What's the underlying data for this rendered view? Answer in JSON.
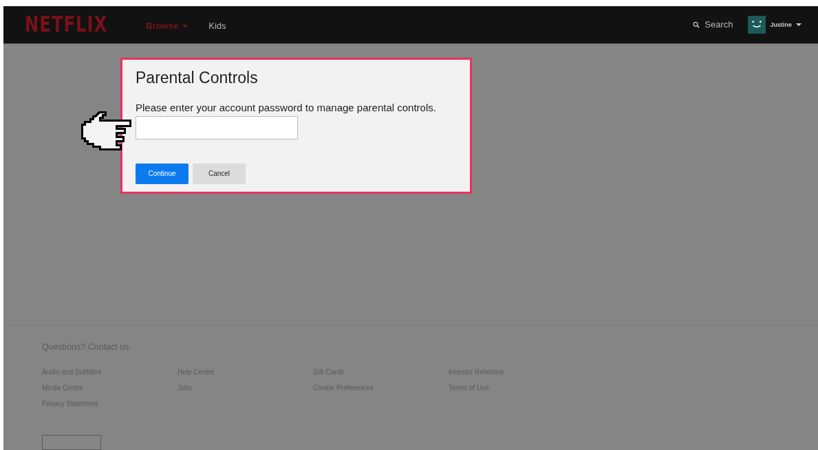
{
  "header": {
    "logo": "NETFLIX",
    "nav": [
      {
        "label": "Browse",
        "selected": true,
        "dropdown": true
      },
      {
        "label": "Kids",
        "selected": false,
        "dropdown": false
      }
    ],
    "search": "Search",
    "profile": {
      "name": "Justine"
    }
  },
  "dialog": {
    "title": "Parental Controls",
    "prompt": "Please enter your account password to manage parental controls.",
    "buttons": [
      {
        "label": "Continue",
        "kind": "primary"
      },
      {
        "label": "Cancel",
        "kind": "secondary"
      }
    ]
  },
  "footer": {
    "contact": "Questions? Contact us.",
    "links": [
      "Audio and Subtitles",
      "Help Centre",
      "Gift Cards",
      "Investor Relations",
      "Media Centre",
      "Jobs",
      "Cookie Preferences",
      "Terms of Use",
      "Privacy Statement"
    ]
  }
}
